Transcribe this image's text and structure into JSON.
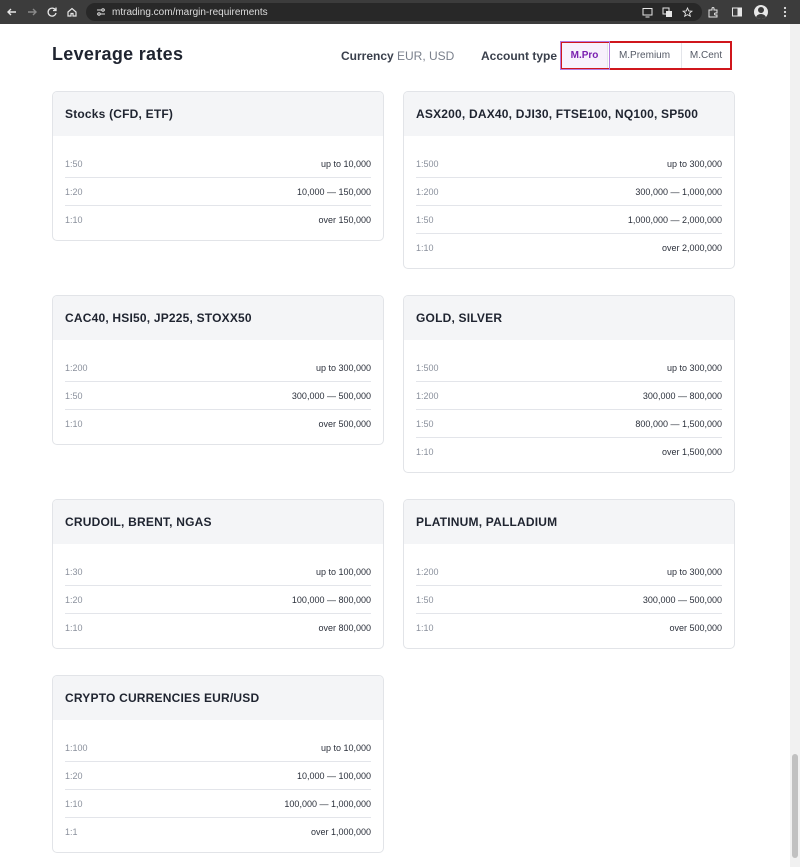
{
  "browser": {
    "url": "mtrading.com/margin-requirements"
  },
  "header": {
    "title": "Leverage rates",
    "currency_label": "Currency",
    "currency_value": "EUR, USD",
    "account_type_label": "Account type",
    "account_tabs": [
      "M.Pro",
      "M.Premium",
      "M.Cent"
    ],
    "active_tab": "M.Pro"
  },
  "colors": {
    "accent_purple": "#7a1fb0",
    "highlight_red": "#d0161c",
    "card_header_bg": "#f4f5f7"
  },
  "cards": [
    {
      "title": "Stocks (CFD, ETF)",
      "rows": [
        {
          "ratio": "1:50",
          "range": "up to 10,000"
        },
        {
          "ratio": "1:20",
          "range": "10,000 — 150,000"
        },
        {
          "ratio": "1:10",
          "range": "over 150,000"
        }
      ]
    },
    {
      "title": "ASX200, DAX40, DJI30, FTSE100, NQ100, SP500",
      "rows": [
        {
          "ratio": "1:500",
          "range": "up to 300,000"
        },
        {
          "ratio": "1:200",
          "range": "300,000 — 1,000,000"
        },
        {
          "ratio": "1:50",
          "range": "1,000,000 — 2,000,000"
        },
        {
          "ratio": "1:10",
          "range": "over 2,000,000"
        }
      ]
    },
    {
      "title": "CAC40, HSI50, JP225, STOXX50",
      "rows": [
        {
          "ratio": "1:200",
          "range": "up to 300,000"
        },
        {
          "ratio": "1:50",
          "range": "300,000 — 500,000"
        },
        {
          "ratio": "1:10",
          "range": "over 500,000"
        }
      ]
    },
    {
      "title": "GOLD, SILVER",
      "rows": [
        {
          "ratio": "1:500",
          "range": "up to 300,000"
        },
        {
          "ratio": "1:200",
          "range": "300,000 — 800,000"
        },
        {
          "ratio": "1:50",
          "range": "800,000 — 1,500,000"
        },
        {
          "ratio": "1:10",
          "range": "over 1,500,000"
        }
      ]
    },
    {
      "title": "CRUDOIL, BRENT, NGAS",
      "rows": [
        {
          "ratio": "1:30",
          "range": "up to 100,000"
        },
        {
          "ratio": "1:20",
          "range": "100,000 — 800,000"
        },
        {
          "ratio": "1:10",
          "range": "over 800,000"
        }
      ]
    },
    {
      "title": "PLATINUM, PALLADIUM",
      "rows": [
        {
          "ratio": "1:200",
          "range": "up to 300,000"
        },
        {
          "ratio": "1:50",
          "range": "300,000 — 500,000"
        },
        {
          "ratio": "1:10",
          "range": "over 500,000"
        }
      ]
    },
    {
      "title": "CRYPTO CURRENCIES EUR/USD",
      "rows": [
        {
          "ratio": "1:100",
          "range": "up to 10,000"
        },
        {
          "ratio": "1:20",
          "range": "10,000 — 100,000"
        },
        {
          "ratio": "1:10",
          "range": "100,000 — 1,000,000"
        },
        {
          "ratio": "1:1",
          "range": "over 1,000,000"
        }
      ]
    }
  ]
}
